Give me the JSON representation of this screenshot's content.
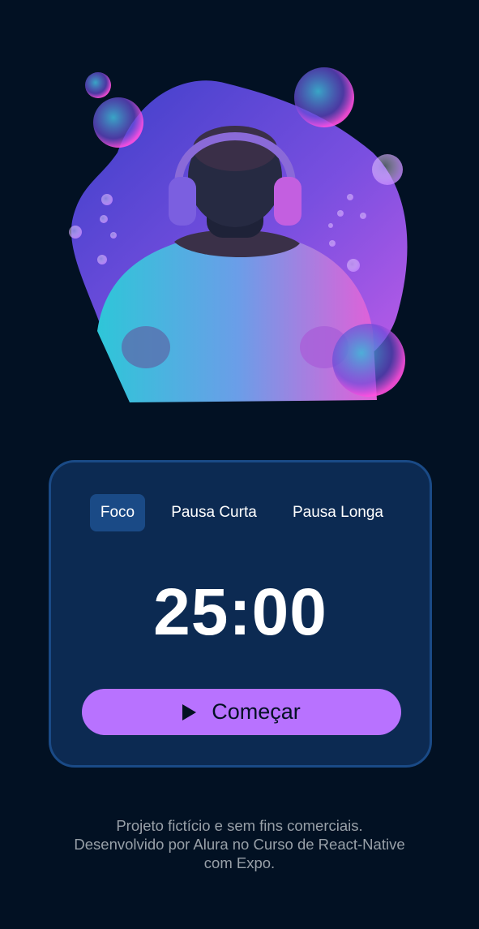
{
  "hero": {
    "image_label": "man-with-headphones-illustration"
  },
  "timer_card": {
    "tabs": [
      {
        "label": "Foco",
        "active": true
      },
      {
        "label": "Pausa Curta",
        "active": false
      },
      {
        "label": "Pausa Longa",
        "active": false
      }
    ],
    "time": "25:00",
    "start_button": {
      "label": "Começar",
      "icon": "play-icon"
    }
  },
  "footer": {
    "lines": [
      "Projeto fictício e sem fins comerciais.",
      "Desenvolvido por Alura no Curso de React-Native",
      "com Expo."
    ]
  },
  "colors": {
    "background": "#021123",
    "card": "#0c2a52",
    "card_border": "#1a4a86",
    "accent": "#b872ff",
    "text": "#ffffff",
    "footer_text": "#98a0a8"
  }
}
